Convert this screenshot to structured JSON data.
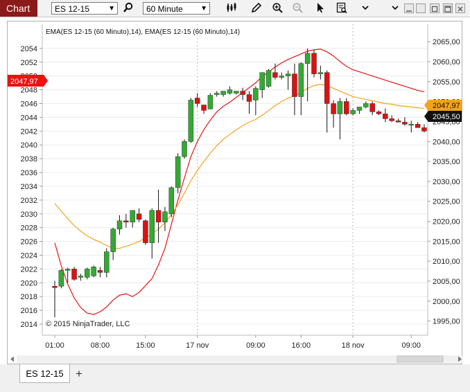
{
  "app": {
    "title": "Chart"
  },
  "toolbar": {
    "instrument": "ES 12-15",
    "interval": "60 Minute",
    "icons": [
      "search-icon",
      "bar-style-icon",
      "pencil-icon",
      "zoom-in-icon",
      "zoom-out-icon",
      "pointer-icon",
      "properties-icon",
      "chevron-down-icon"
    ]
  },
  "window_controls": [
    "minimize",
    "maximize",
    "close"
  ],
  "chart": {
    "indicator_label": "EMA(ES 12-15 (60 Minuto),14), EMA(ES 12-15 (60 Minuto),14)",
    "copyright": "© 2015 NinjaTrader, LLC",
    "left_price_marker": "2047,97",
    "right_markers": {
      "ema_fast": "2047,97",
      "last_price": "2045,50"
    },
    "colors": {
      "up": "#33aa33",
      "down": "#dd1111",
      "ema_red": "#e51515",
      "ema_orange": "#f5a21a",
      "marker_red": "#ee1111",
      "marker_black": "#111111"
    }
  },
  "chart_data": {
    "type": "candlestick",
    "left_axis": {
      "ylim": [
        2013,
        2057
      ],
      "ticks": [
        "2014",
        "2016",
        "2018",
        "2020",
        "2022",
        "2024",
        "2026",
        "2028",
        "2030",
        "2032",
        "2034",
        "2036",
        "2038",
        "2040",
        "2042",
        "2044",
        "2046",
        "2048",
        "2050",
        "2052",
        "2054"
      ]
    },
    "right_axis": {
      "ylim": [
        1992.5,
        2068.5
      ],
      "ticks": [
        "1995,00",
        "2000,00",
        "2005,00",
        "2010,00",
        "2015,00",
        "2020,00",
        "2025,00",
        "2030,00",
        "2035,00",
        "2040,00",
        "2045,00",
        "2050,00",
        "2055,00",
        "2060,00",
        "2065,00"
      ]
    },
    "x_ticks": [
      {
        "label": "01:00",
        "bar": 0
      },
      {
        "label": "08:00",
        "bar": 7
      },
      {
        "label": "15:00",
        "bar": 14
      },
      {
        "label": "17 nov",
        "bar": 22
      },
      {
        "label": "09:00",
        "bar": 31
      },
      {
        "label": "16:00",
        "bar": 38
      },
      {
        "label": "18 nov",
        "bar": 46
      },
      {
        "label": "09:00",
        "bar": 55
      }
    ],
    "day_separators": [
      22,
      46
    ],
    "candles": [
      [
        2019.5,
        2020.3,
        2015,
        2019.3
      ],
      [
        2019.5,
        2022.0,
        2019.2,
        2021.8
      ],
      [
        2021.8,
        2022.2,
        2020.0,
        2022.0
      ],
      [
        2022.0,
        2022.3,
        2020.3,
        2020.5
      ],
      [
        2020.8,
        2021.3,
        2020.3,
        2021.0
      ],
      [
        2020.8,
        2022.2,
        2020.5,
        2022.0
      ],
      [
        2021.0,
        2022.5,
        2020.8,
        2022.3
      ],
      [
        2021.8,
        2022.3,
        2020.8,
        2021.5
      ],
      [
        2021.5,
        2025.0,
        2020.8,
        2024.5
      ],
      [
        2024.5,
        2028.0,
        2023.3,
        2027.8
      ],
      [
        2027.8,
        2029.8,
        2027.0,
        2029.0
      ],
      [
        2029.0,
        2030.0,
        2028.0,
        2028.8
      ],
      [
        2028.8,
        2030.5,
        2028.0,
        2030.5
      ],
      [
        2030.0,
        2030.8,
        2028.8,
        2029.2
      ],
      [
        2029.0,
        2029.2,
        2025.5,
        2025.8
      ],
      [
        2025.8,
        2030.8,
        2023.5,
        2030.5
      ],
      [
        2030.5,
        2033.5,
        2025.8,
        2028.8
      ],
      [
        2028.8,
        2031.0,
        2027.5,
        2030.3
      ],
      [
        2030.0,
        2034.0,
        2029.5,
        2033.8
      ],
      [
        2033.8,
        2038.8,
        2033.0,
        2038.3
      ],
      [
        2038.3,
        2040.8,
        2038.0,
        2040.5
      ],
      [
        2040.5,
        2046.8,
        2040.3,
        2046.5
      ],
      [
        2046.8,
        2047.5,
        2045.5,
        2046.0
      ],
      [
        2045.8,
        2045.8,
        2044.5,
        2045.0
      ],
      [
        2045.2,
        2047.5,
        2045.2,
        2047.2
      ],
      [
        2047.3,
        2047.8,
        2047.0,
        2047.5
      ],
      [
        2047.3,
        2047.8,
        2047.0,
        2047.8
      ],
      [
        2047.5,
        2048.5,
        2047.3,
        2048.0
      ],
      [
        2047.5,
        2047.8,
        2047.3,
        2047.8
      ],
      [
        2047.8,
        2048.3,
        2046.5,
        2047.3
      ],
      [
        2047.3,
        2047.8,
        2044.5,
        2046.3
      ],
      [
        2046.5,
        2048.5,
        2044.3,
        2048.2
      ],
      [
        2048.0,
        2050.0,
        2046.8,
        2050.5
      ],
      [
        2048.5,
        2051.0,
        2048.3,
        2050.8
      ],
      [
        2050.5,
        2051.8,
        2049.5,
        2049.8
      ],
      [
        2049.8,
        2050.5,
        2049.5,
        2050.0
      ],
      [
        2050.0,
        2050.8,
        2048.0,
        2050.3
      ],
      [
        2050.3,
        2051.8,
        2044.3,
        2047.0
      ],
      [
        2047.0,
        2052.0,
        2044.3,
        2051.8
      ],
      [
        2051.8,
        2054.0,
        2046.3,
        2053.3
      ],
      [
        2053.3,
        2053.8,
        2049.8,
        2050.3
      ],
      [
        2050.3,
        2051.5,
        2049.5,
        2050.5
      ],
      [
        2050.5,
        2050.8,
        2041.8,
        2046.0
      ],
      [
        2046.0,
        2046.5,
        2042.5,
        2044.5
      ],
      [
        2044.5,
        2046.8,
        2040.8,
        2046.3
      ],
      [
        2046.3,
        2046.8,
        2044.3,
        2044.5
      ],
      [
        2044.5,
        2045.3,
        2044.3,
        2045.0
      ],
      [
        2045.0,
        2045.3,
        2044.5,
        2045.5
      ],
      [
        2045.5,
        2046.3,
        2045.3,
        2046.0
      ],
      [
        2046.0,
        2046.3,
        2044.3,
        2044.8
      ],
      [
        2044.8,
        2045.0,
        2044.3,
        2044.5
      ],
      [
        2044.5,
        2045.3,
        2043.3,
        2043.8
      ],
      [
        2043.8,
        2044.3,
        2043.3,
        2043.5
      ],
      [
        2043.5,
        2043.8,
        2043.3,
        2043.3
      ],
      [
        2043.3,
        2044.0,
        2042.8,
        2043.0
      ],
      [
        2043.0,
        2043.5,
        2041.8,
        2043.0
      ],
      [
        2043.0,
        2043.3,
        2042.5,
        2042.5
      ],
      [
        2042.5,
        2043.0,
        2041.8,
        2042.0
      ]
    ],
    "ema_red": [
      2025.8,
      2022.5,
      2019.8,
      2017.8,
      2016.4,
      2015.6,
      2015.4,
      2015.8,
      2016.5,
      2017.5,
      2018.2,
      2018.4,
      2018.0,
      2018.6,
      2019.6,
      2020.6,
      2022.6,
      2025.0,
      2028.5,
      2032.0,
      2035.2,
      2038.3,
      2040.5,
      2042.2,
      2043.6,
      2044.8,
      2045.6,
      2046.2,
      2046.9,
      2047.6,
      2048.3,
      2049.0,
      2049.9,
      2050.6,
      2051.3,
      2051.9,
      2052.4,
      2052.8,
      2053.2,
      2053.6,
      2053.8,
      2053.9,
      2053.5,
      2052.9,
      2052.1,
      2051.4,
      2050.9,
      2050.6,
      2050.3,
      2050.0,
      2049.7,
      2049.4,
      2049.1,
      2048.8,
      2048.5,
      2048.2,
      2047.9,
      2047.7
    ],
    "ema_orange": [
      2031.5,
      2030.4,
      2029.3,
      2028.3,
      2027.5,
      2026.8,
      2026.3,
      2025.9,
      2025.4,
      2025.0,
      2025.0,
      2025.3,
      2025.6,
      2026.0,
      2026.5,
      2027.1,
      2027.8,
      2028.7,
      2029.9,
      2031.3,
      2033.0,
      2034.8,
      2036.3,
      2037.6,
      2038.8,
      2039.9,
      2040.8,
      2041.5,
      2042.2,
      2042.8,
      2043.3,
      2043.7,
      2044.3,
      2045.0,
      2045.7,
      2046.3,
      2046.8,
      2047.1,
      2047.6,
      2048.2,
      2048.6,
      2048.8,
      2048.6,
      2048.2,
      2047.8,
      2047.4,
      2047.0,
      2046.8,
      2046.6,
      2046.4,
      2046.2,
      2046.0,
      2045.9,
      2045.7,
      2045.6,
      2045.5,
      2045.4,
      2045.3
    ]
  },
  "status": {
    "tabs": [
      "ES 12-15"
    ],
    "add_tab_label": "+"
  }
}
